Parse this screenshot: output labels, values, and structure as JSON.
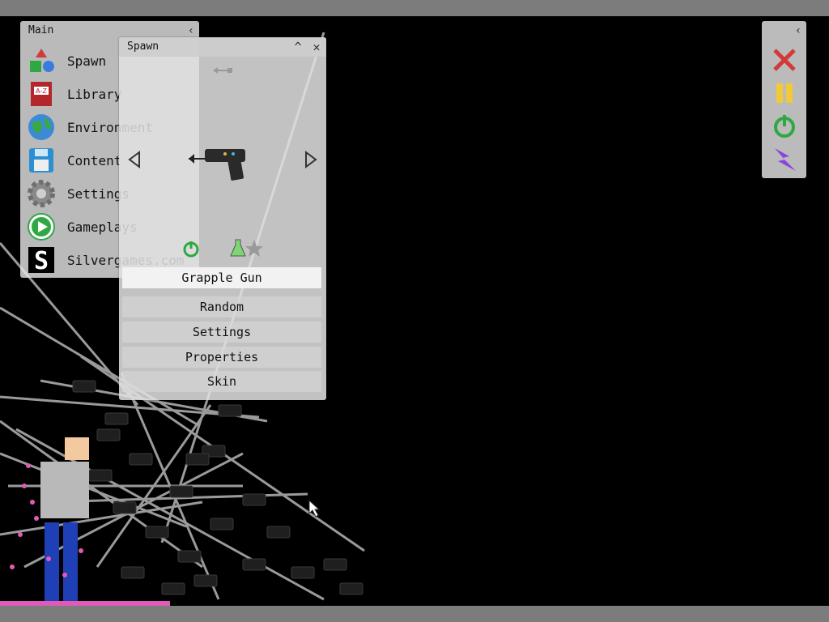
{
  "main_panel": {
    "title": "Main",
    "collapse_glyph": "‹",
    "items": [
      {
        "label": "Spawn",
        "icon": "shapes-icon"
      },
      {
        "label": "Library",
        "icon": "book-icon"
      },
      {
        "label": "Environment",
        "icon": "globe-icon"
      },
      {
        "label": "Content",
        "icon": "floppy-disk-icon"
      },
      {
        "label": "Settings",
        "icon": "gear-icon"
      },
      {
        "label": "Gameplays",
        "icon": "play-icon"
      },
      {
        "label": "Silvergames.com",
        "icon": "silvergames-logo-icon"
      }
    ]
  },
  "spawn_panel": {
    "title": "Spawn",
    "minimize_glyph": "^",
    "close_glyph": "✕",
    "selected_item": "Grapple Gun",
    "buttons": [
      "Random",
      "Settings",
      "Properties",
      "Skin"
    ]
  },
  "tool_panel": {
    "collapse_glyph": "‹",
    "tools": [
      "close-icon",
      "pause-icon",
      "power-icon",
      "lightning-icon"
    ]
  },
  "colors": {
    "background": "#000000",
    "frame": "#7c7c7c",
    "panel": "#e8e8e8",
    "red": "#d23a3a",
    "yellow": "#f2c938",
    "green": "#2fa843",
    "purple": "#8a46e0"
  }
}
